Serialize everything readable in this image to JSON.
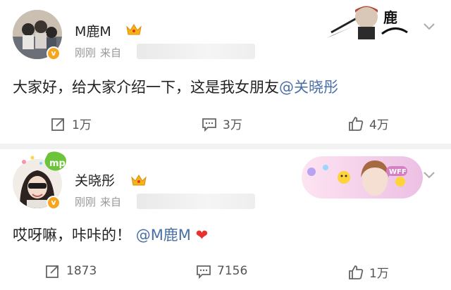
{
  "posts": [
    {
      "username": "M鹿M",
      "time": "刚刚",
      "source_prefix": "来自",
      "text": "大家好，给大家介绍一下，这是我女朋友",
      "mention": "@关晓彤",
      "actions": {
        "repost": "1万",
        "comment": "3万",
        "like": "4万"
      },
      "icons": [
        "crown-icon",
        "verified-badge-icon",
        "chevron-down-icon",
        "repost-icon",
        "comment-icon",
        "like-icon"
      ]
    },
    {
      "username": "关晓彤",
      "time": "刚刚",
      "source_prefix": "来自",
      "text": "哎呀嘛，咔咔的！",
      "mention": "@M鹿M",
      "emoji": "❤",
      "actions": {
        "repost": "1873",
        "comment": "7156",
        "like": "1万"
      },
      "icons": [
        "crown-icon",
        "verified-badge-icon",
        "chevron-down-icon",
        "repost-icon",
        "comment-icon",
        "like-icon"
      ]
    }
  ],
  "colors": {
    "mention": "#4a6fa5",
    "meta": "#999999",
    "badge": "#f7a51c",
    "heart": "#e8312f",
    "separator": "#f2f2f2"
  },
  "banner_1": {
    "text": "鹿"
  },
  "banner_2": {
    "tag": "WFF"
  }
}
